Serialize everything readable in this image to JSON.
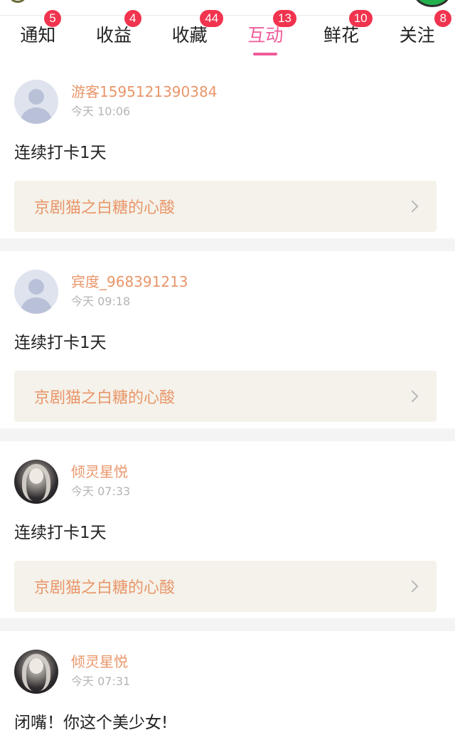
{
  "tabs": [
    {
      "label": "通知",
      "badge": "5",
      "active": false
    },
    {
      "label": "收益",
      "badge": "4",
      "active": false
    },
    {
      "label": "收藏",
      "badge": "44",
      "active": false
    },
    {
      "label": "互动",
      "badge": "13",
      "active": true
    },
    {
      "label": "鲜花",
      "badge": "10",
      "active": false
    },
    {
      "label": "关注",
      "badge": "8",
      "active": false
    }
  ],
  "items": [
    {
      "username": "游客1595121390384",
      "time": "今天 10:06",
      "content": "连续打卡1天",
      "ref_title": "京剧猫之白糖的心酸",
      "avatar": "default-avatar"
    },
    {
      "username": "宾度_968391213",
      "time": "今天 09:18",
      "content": "连续打卡1天",
      "ref_title": "京剧猫之白糖的心酸",
      "avatar": "default-avatar"
    },
    {
      "username": "倾灵星悦",
      "time": "今天 07:33",
      "content": "连续打卡1天",
      "ref_title": "京剧猫之白糖的心酸",
      "avatar": "photo-avatar"
    },
    {
      "username": "倾灵星悦",
      "time": "今天 07:31",
      "content": "闭嘴！你这个美少女!",
      "avatar": "photo-avatar"
    }
  ],
  "colors": {
    "accent": "#ef5c9a",
    "badge": "#f0334e",
    "username": "#e9966a",
    "ref_bg": "#f4f2ea"
  },
  "icons": {
    "chevron": "chevron-right-icon"
  }
}
